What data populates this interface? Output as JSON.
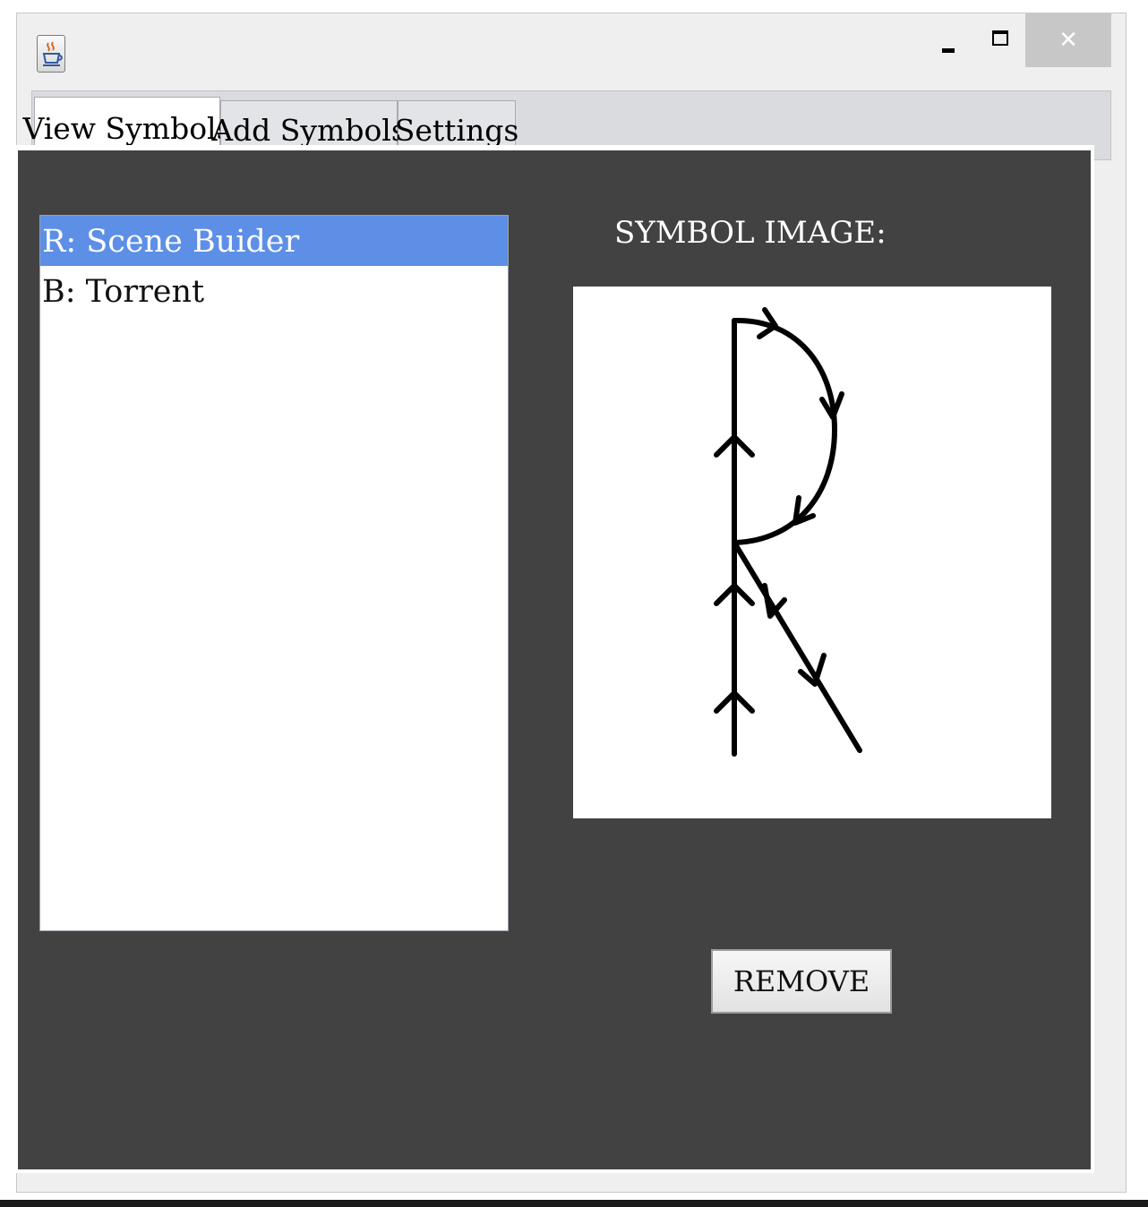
{
  "window": {
    "controls": {
      "minimize": "minimize",
      "maximize": "maximize",
      "close": "✕"
    }
  },
  "tabs": [
    {
      "label": "View Symbols",
      "active": true
    },
    {
      "label": "Add Symbols",
      "active": false
    },
    {
      "label": "Settings",
      "active": false
    }
  ],
  "symbol_list": {
    "items": [
      "R: Scene Buider",
      "B: Torrent"
    ],
    "selected_index": 0
  },
  "image_panel": {
    "label": "SYMBOL IMAGE:",
    "symbol": "R"
  },
  "actions": {
    "remove_label": "REMOVE"
  },
  "colors": {
    "content_background": "#424242",
    "selection": "#5d8fe6",
    "tab_strip": "#d9dbdf"
  }
}
